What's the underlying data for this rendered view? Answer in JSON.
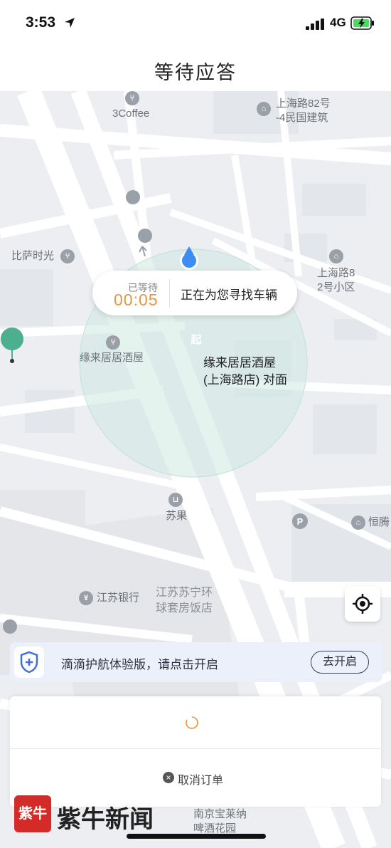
{
  "status_bar": {
    "time": "3:53",
    "network": "4G"
  },
  "header": {
    "title": "等待应答"
  },
  "map": {
    "pois": [
      {
        "name": "3Coffee",
        "icon": "fork-knife-icon"
      },
      {
        "name": "上海路82号\n-4民国建筑",
        "icon": "building-icon"
      },
      {
        "name": "比萨时光",
        "icon": "fork-knife-icon"
      },
      {
        "name": "上海路8\n2号小区",
        "icon": "building-icon"
      },
      {
        "name": "缘来居居酒屋",
        "icon": "fork-knife-icon"
      },
      {
        "name": "苏果",
        "icon": "cart-icon"
      },
      {
        "name": "恒腾",
        "icon": "building-icon"
      },
      {
        "name": "江苏银行",
        "icon": "yuan-icon"
      },
      {
        "name": "江苏苏宁环\n球套房饭店",
        "icon": ""
      },
      {
        "name": "南京宝莱纳\n啤酒花园",
        "icon": ""
      }
    ],
    "pickup_label": "缘来居居酒屋\n(上海路店) 对面",
    "pin_label": "起"
  },
  "wait_bubble": {
    "label": "已等待",
    "time": "00:05",
    "message": "正在为您寻找车辆"
  },
  "safety_bar": {
    "text": "滴滴护航体验版，请点击开启",
    "button": "去开启"
  },
  "panel": {
    "cancel_label": "取消订单"
  },
  "watermark": {
    "logo": "紫牛",
    "text": "紫牛新闻"
  },
  "colors": {
    "accent_orange": "#e8963c",
    "pin_green": "#4caf8e",
    "location_blue": "#3d8df5"
  }
}
